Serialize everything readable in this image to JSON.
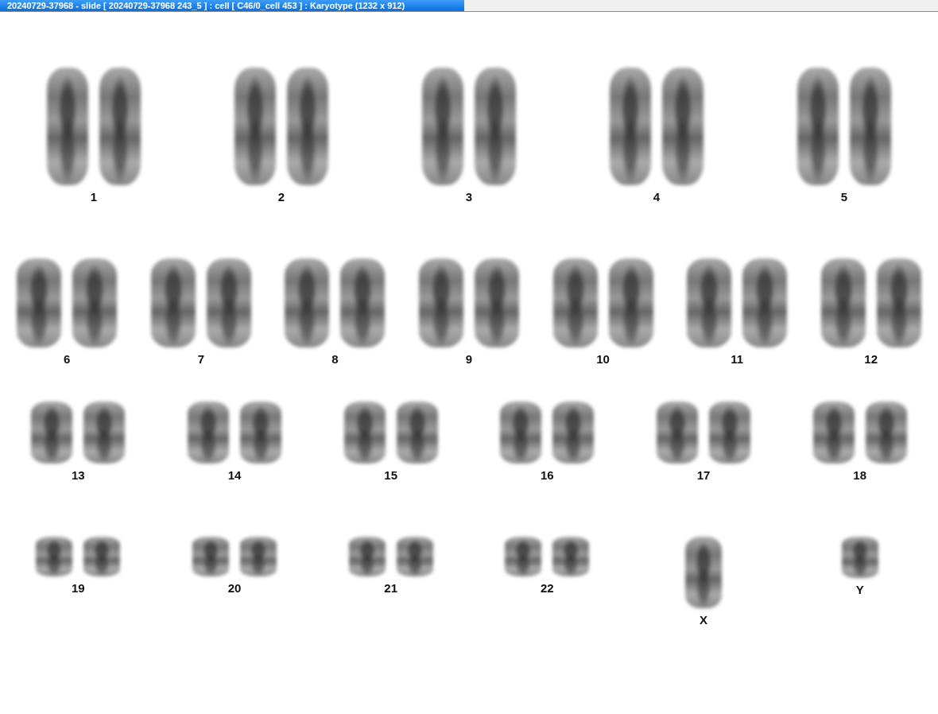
{
  "window": {
    "title": "20240729-37968 - slide [ 20240729-37968 243_5 ] : cell [ C46/0_cell 453 ] : Karyotype  (1232 x 912)"
  },
  "karyogram": {
    "rows": [
      {
        "groups": [
          {
            "label": "1",
            "kind": "pair"
          },
          {
            "label": "2",
            "kind": "pair"
          },
          {
            "label": "3",
            "kind": "pair"
          },
          {
            "label": "4",
            "kind": "pair"
          },
          {
            "label": "5",
            "kind": "pair"
          }
        ]
      },
      {
        "groups": [
          {
            "label": "6",
            "kind": "pair"
          },
          {
            "label": "7",
            "kind": "pair"
          },
          {
            "label": "8",
            "kind": "pair"
          },
          {
            "label": "9",
            "kind": "pair"
          },
          {
            "label": "10",
            "kind": "pair"
          },
          {
            "label": "11",
            "kind": "pair"
          },
          {
            "label": "12",
            "kind": "pair"
          }
        ]
      },
      {
        "groups": [
          {
            "label": "13",
            "kind": "pair"
          },
          {
            "label": "14",
            "kind": "pair"
          },
          {
            "label": "15",
            "kind": "pair"
          },
          {
            "label": "16",
            "kind": "pair"
          },
          {
            "label": "17",
            "kind": "pair"
          },
          {
            "label": "18",
            "kind": "pair"
          }
        ]
      },
      {
        "groups": [
          {
            "label": "19",
            "kind": "pair"
          },
          {
            "label": "20",
            "kind": "pair"
          },
          {
            "label": "21",
            "kind": "pair"
          },
          {
            "label": "22",
            "kind": "pair"
          },
          {
            "label": "X",
            "kind": "single"
          },
          {
            "label": "Y",
            "kind": "single"
          }
        ]
      }
    ]
  }
}
